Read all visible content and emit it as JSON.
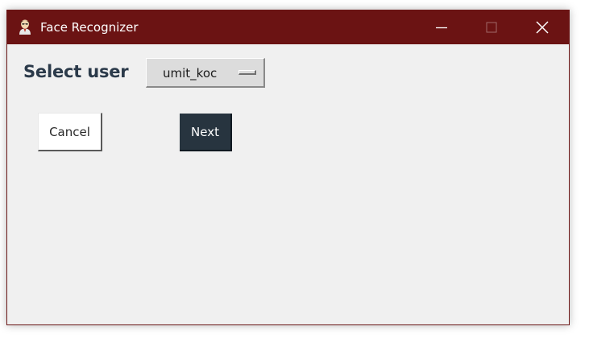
{
  "window": {
    "title": "Face Recognizer",
    "app_icon": "face-recognizer-app-icon",
    "titlebar_color": "#6b1313",
    "controls": {
      "minimize_icon": "minimize-icon",
      "maximize_icon": "maximize-icon",
      "close_icon": "close-icon"
    }
  },
  "form": {
    "select_label": "Select user",
    "user_dropdown": {
      "selected_value": "umit_koc"
    },
    "cancel_label": "Cancel",
    "next_label": "Next",
    "next_color": "#27343f"
  }
}
